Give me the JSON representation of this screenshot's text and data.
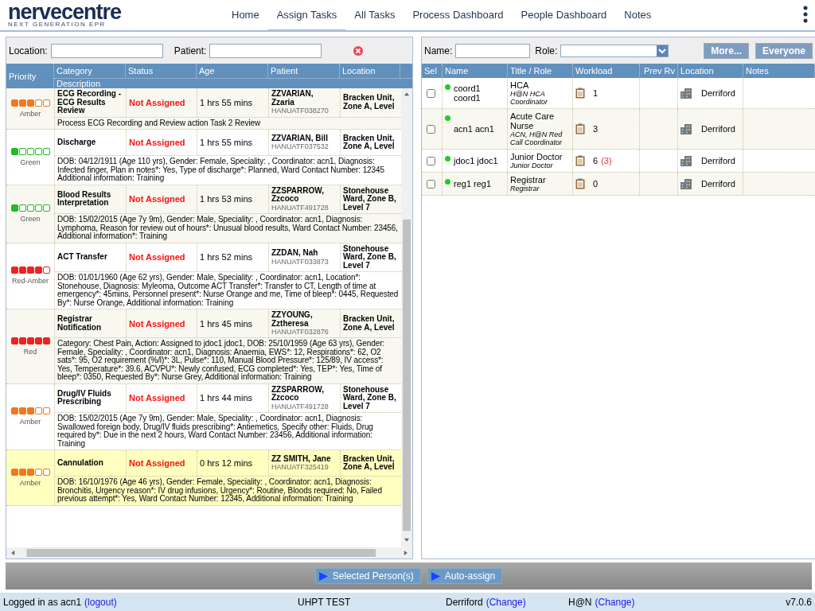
{
  "brand": {
    "name": "nervecentre",
    "tagline": "NEXT GENERATION EPR"
  },
  "nav": [
    {
      "label": "Home",
      "selected": false
    },
    {
      "label": "Assign Tasks",
      "selected": true
    },
    {
      "label": "All Tasks",
      "selected": false
    },
    {
      "label": "Process Dashboard",
      "selected": false
    },
    {
      "label": "People Dashboard",
      "selected": false
    },
    {
      "label": "Notes",
      "selected": false
    }
  ],
  "task_filters": {
    "location_label": "Location:",
    "patient_label": "Patient:"
  },
  "task_table": {
    "columns": [
      "Priority",
      "Category",
      "Status",
      "Age",
      "Patient",
      "Location"
    ],
    "description_header": "Description",
    "rows": [
      {
        "priority": "Amber",
        "color": "#f07820",
        "stars": 3,
        "category": "ECG Recording - ECG Results Review",
        "status": "Not Assigned",
        "age": "1 hrs 55 mins",
        "patient": "ZZVARIAN, Zzaria",
        "patient_id": "HANUATF038270",
        "location": "Bracken Unit, Zone A, Level",
        "description": "Process ECG Recording and Review action Task 2 Review",
        "selected": false
      },
      {
        "priority": "Green",
        "color": "#22bb22",
        "stars": 1,
        "category": "Discharge",
        "status": "Not Assigned",
        "age": "1 hrs 55 mins",
        "patient": "ZZVARIAN, Bill",
        "patient_id": "HANUATF037532",
        "location": "Bracken Unit, Zone A, Level",
        "description": "DOB: 04/12/1911 (Age 110 yrs), Gender: Female, Speciality: , Coordinator: acn1, Diagnosis: Infected finger, Plan in notes*: Yes, Type of discharge*: Planned, Ward Contact Number: 12345 Additional information: Training",
        "selected": false
      },
      {
        "priority": "Green",
        "color": "#22bb22",
        "stars": 1,
        "category": "Blood Results Interpretation",
        "status": "Not Assigned",
        "age": "1 hrs 53 mins",
        "patient": "ZZSPARROW, Zzcoco",
        "patient_id": "HANUATF491728",
        "location": "Stonehouse Ward, Zone B, Level 7",
        "description": "DOB: 15/02/2015 (Age 7y 9m), Gender: Male, Speciality: , Coordinator: acn1, Diagnosis: Lymphoma, Reason for review out of hours*: Unusual blood results, Ward Contact Number: 23456, Additional information*: Training",
        "selected": false
      },
      {
        "priority": "Red-Amber",
        "color": "#ee2222",
        "stars": 4,
        "category": "ACT Transfer",
        "status": "Not Assigned",
        "age": "1 hrs 52 mins",
        "patient": "ZZDAN, Nah",
        "patient_id": "HANUATF033873",
        "location": "Stonehouse Ward, Zone B, Level 7",
        "description": "DOB: 01/01/1960 (Age 62 yrs), Gender: Male, Speciality: , Coordinator: acn1, Location*: Stonehouse, Diagnosis: Myleoma, Outcome ACT Transfer*: Transfer to CT, Length of time at emergency*: 45mins, Personnel present*: Nurse Orange and me, Time of bleep*: 0445, Requested By*: Nurse Orange, Additional information: Training",
        "selected": false
      },
      {
        "priority": "Red",
        "color": "#ee2222",
        "stars": 5,
        "category": "Registrar Notification",
        "status": "Not Assigned",
        "age": "1 hrs 45 mins",
        "patient": "ZZYOUNG, Zztheresa",
        "patient_id": "HANUATF032876",
        "location": "Bracken Unit, Zone A, Level",
        "description": "Category: Chest Pain, Action: Assigned to jdoc1 jdoc1, DOB: 25/10/1959 (Age 63 yrs), Gender: Female, Speciality: , Coordinator: acn1, Diagnosis: Anaemia, EWS*: 12, Respirations*: 62, O2 sats*: 95, O2 requirement (%/l)*: 3L, Pulse*: 110, Manual Blood Pressure*: 125/89, IV access*: Yes, Temperature*: 39.6, ACVPU*: Newly confused, ECG completed*: Yes, TEP*: Yes, Time of bleep*: 0350, Requested By*: Nurse Grey, Additional information: Training",
        "selected": false
      },
      {
        "priority": "Amber",
        "color": "#f07820",
        "stars": 3,
        "category": "Drug/IV Fluids Prescribing",
        "status": "Not Assigned",
        "age": "1 hrs 44 mins",
        "patient": "ZZSPARROW, Zzcoco",
        "patient_id": "HANUATF491728",
        "location": "Stonehouse Ward, Zone B, Level 7",
        "description": "DOB: 15/02/2015 (Age 7y 9m), Gender: Male, Speciality: , Coordinator: acn1, Diagnosis: Swallowed foreign body, Drug/IV fluids prescribing*: Antiemetics, Specify other: Fluids, Drug required by*: Due in the next 2 hours, Ward Contact Number: 23456, Additional information: Training",
        "selected": false
      },
      {
        "priority": "Amber",
        "color": "#f07820",
        "stars": 3,
        "category": "Cannulation",
        "status": "Not Assigned",
        "age": "0 hrs 12 mins",
        "patient": "ZZ SMITH, Jane",
        "patient_id": "HANUATF325419",
        "location": "Bracken Unit, Zone A, Level",
        "description": "DOB: 16/10/1976 (Age 46 yrs), Gender: Female, Speciality: , Coordinator: acn1, Diagnosis: Bronchitis, Urgency reason*: IV drug infusions, Urgency*: Routine, Bloods required: No, Failed previous attempt*: Yes, Ward Contact Number: 12345, Additional information: Training",
        "selected": true
      }
    ]
  },
  "people_filters": {
    "name_label": "Name:",
    "role_label": "Role:",
    "buttons": [
      {
        "label": "More...",
        "disabled": true
      },
      {
        "label": "Everyone",
        "disabled": true
      }
    ]
  },
  "people_table": {
    "columns": [
      "Sel",
      "Name",
      "Title / Role",
      "Workload",
      "Prev Rv",
      "Location",
      "Notes"
    ],
    "rows": [
      {
        "checked": false,
        "online": true,
        "name": "coord1 coord1",
        "title": "HCA",
        "role": "H@N HCA Coordinator",
        "workload": "1",
        "location": "Derriford"
      },
      {
        "checked": false,
        "online": true,
        "name": "acn1 acn1",
        "title": "Acute Care Nurse",
        "role": "ACN, H@N Red Call Coordinator",
        "workload": "3",
        "location": "Derriford"
      },
      {
        "checked": false,
        "online": true,
        "name": "jdoc1 jdoc1",
        "title": "Junior Doctor",
        "role": "Junior Doctor",
        "workload": "6",
        "workload_extra": "(3)",
        "location": "Derriford"
      },
      {
        "checked": false,
        "online": true,
        "name": "reg1 reg1",
        "title": "Registrar",
        "role": "Registrar",
        "workload": "0",
        "location": "Derriford"
      }
    ]
  },
  "actions": [
    "Selected Person(s)",
    "Auto-assign"
  ],
  "status_bar": {
    "user": "Logged in as acn1",
    "logout": "(logout)",
    "site": "UHPT TEST",
    "location": "Derriford",
    "location_change": "(Change)",
    "team": "H@N",
    "team_change": "(Change)",
    "version": "v7.0.6"
  }
}
